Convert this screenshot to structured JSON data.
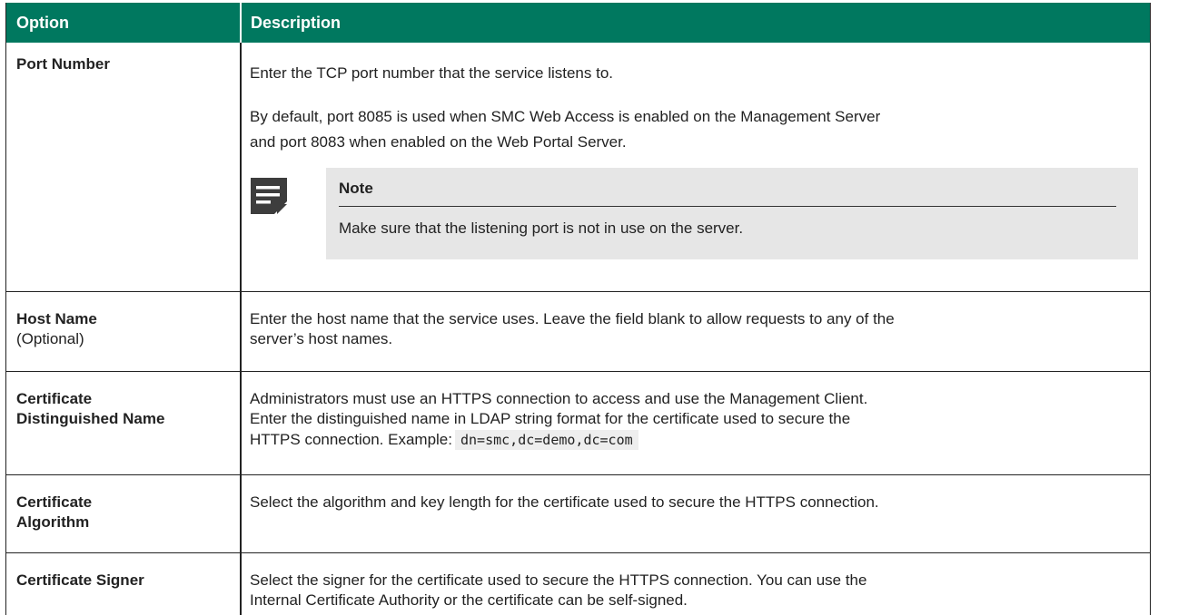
{
  "header": {
    "option_label": "Option",
    "description_label": "Description"
  },
  "rows": [
    {
      "option": "Port Number",
      "description": [
        "Enter the TCP port number that the service listens to.",
        "By default, port 8085 is used when SMC Web Access is enabled on the Management Server",
        "and port 8083 when enabled on the Web Portal Server."
      ],
      "note": {
        "icon": "note-icon",
        "title": "Note",
        "text": "Make sure that the listening port is not in use on the server."
      }
    },
    {
      "option": "Host Name",
      "option_sub": "(Optional)",
      "description": [
        "Enter the host name that the service uses. Leave the field blank to allow requests to any of the",
        "server’s host names."
      ]
    },
    {
      "option_lines": [
        "Certificate",
        "Distinguished Name"
      ],
      "description": [
        "Administrators must use an HTTPS connection to access and use the Management Client.",
        "Enter the distinguished name in LDAP string format for the certificate used to secure the",
        "HTTPS connection. Example:"
      ],
      "code_example": "dn=smc,dc=demo,dc=com"
    },
    {
      "option_lines": [
        "Certificate",
        "Algorithm"
      ],
      "description": [
        "Select the algorithm and key length for the certificate used to secure the HTTPS connection."
      ]
    },
    {
      "option": "Certificate Signer",
      "description": [
        "Select the signer for the certificate used to secure the HTTPS connection. You can use the",
        "Internal Certificate Authority or the certificate can be self-signed."
      ]
    }
  ],
  "colors": {
    "header_bg": "#00785f",
    "header_text": "#ffffff",
    "note_bg": "#e6e6e6",
    "code_bg": "#eeeeee"
  }
}
